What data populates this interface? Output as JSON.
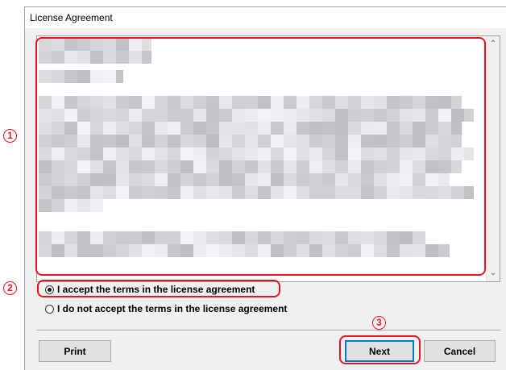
{
  "window": {
    "title": "License Agreement"
  },
  "license_text": {
    "content": ""
  },
  "accept_group": {
    "accept_label": "I accept the terms in the license agreement",
    "decline_label": "I do not accept the terms in the license agreement",
    "selected": "accept"
  },
  "buttons": {
    "print_label": "Print",
    "next_label": "Next",
    "cancel_label": "Cancel"
  },
  "callouts": {
    "one": "1",
    "two": "2",
    "three": "3"
  },
  "colors": {
    "highlight_red": "#e8141e",
    "default_button_border": "#0078d7"
  },
  "scrollbar": {
    "up_icon": "chevron-up-icon",
    "down_icon": "chevron-down-icon"
  }
}
